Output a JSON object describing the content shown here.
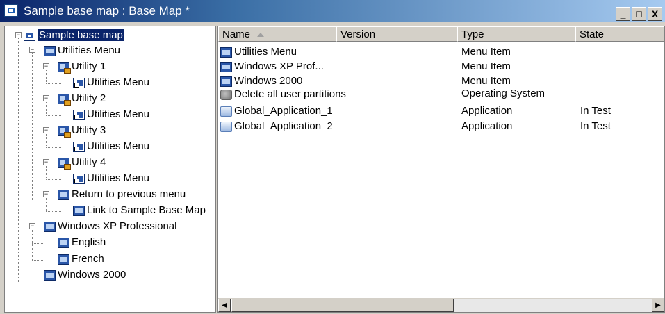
{
  "window": {
    "title": "Sample base map : Base Map *",
    "buttons": {
      "minimize": "_",
      "maximize": "□",
      "close": "X"
    },
    "colors": {
      "titlebar_start": "#0a246a",
      "titlebar_end": "#a6caf0",
      "selection": "#0a246a"
    }
  },
  "tree": {
    "root": "Sample base map",
    "utilities_menu": "Utilities Menu",
    "utility_1": "Utility 1",
    "utility_1_link": "Utilities Menu",
    "utility_2": "Utility 2",
    "utility_2_link": "Utilities Menu",
    "utility_3": "Utility 3",
    "utility_3_link": "Utilities Menu",
    "utility_4": "Utility 4",
    "utility_4_link": "Utilities Menu",
    "return_menu": "Return to previous menu",
    "return_link": "Link to Sample Base Map",
    "winxp": "Windows XP Professional",
    "english": "English",
    "french": "French",
    "win2000": "Windows 2000",
    "expanded_symbol": "−"
  },
  "list": {
    "columns": [
      "Name",
      "Version",
      "Type",
      "State"
    ],
    "sort_column": "Name",
    "rows": [
      {
        "icon": "menu-icon",
        "name": "Utilities Menu",
        "version": "",
        "type": "Menu Item",
        "state": ""
      },
      {
        "icon": "menu-icon",
        "name": "Windows XP Prof...",
        "version": "",
        "type": "Menu Item",
        "state": ""
      },
      {
        "icon": "menu-icon",
        "name": "Windows 2000",
        "version": "",
        "type": "Menu Item",
        "state": ""
      },
      {
        "icon": "operating-system-icon",
        "name": "Delete all user partitions",
        "version": "",
        "type": "Operating System",
        "state": ""
      },
      {
        "icon": "application-icon",
        "name": "Global_Application_1",
        "version": "",
        "type": "Application",
        "state": "In Test"
      },
      {
        "icon": "application-icon",
        "name": "Global_Application_2",
        "version": "",
        "type": "Application",
        "state": "In Test"
      }
    ]
  },
  "scrollbar": {
    "left_arrow": "◀",
    "right_arrow": "▶"
  }
}
